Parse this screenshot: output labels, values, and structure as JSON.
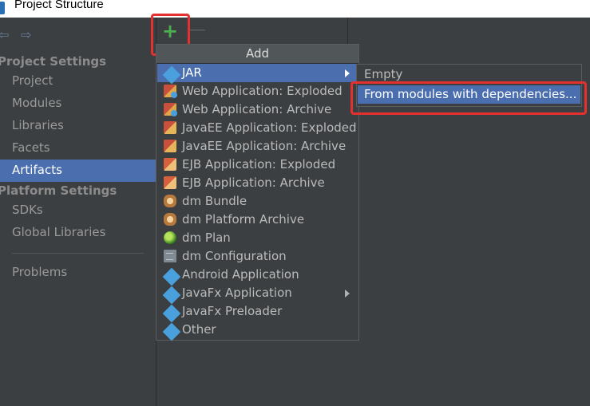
{
  "window": {
    "title": "Project Structure"
  },
  "sidebar": {
    "project_settings_header": "Project Settings",
    "project_items": [
      "Project",
      "Modules",
      "Libraries",
      "Facets",
      "Artifacts"
    ],
    "platform_settings_header": "Platform Settings",
    "platform_items": [
      "SDKs",
      "Global Libraries"
    ],
    "problems": "Problems",
    "selected": "Artifacts"
  },
  "toolbar": {
    "add_symbol": "+",
    "remove_symbol": "—"
  },
  "add_menu": {
    "title": "Add",
    "items": [
      {
        "label": "JAR",
        "icon": "jar-icon",
        "submenu": true,
        "selected": true
      },
      {
        "label": "Web Application: Exploded",
        "icon": "web-app-icon"
      },
      {
        "label": "Web Application: Archive",
        "icon": "web-app-icon"
      },
      {
        "label": "JavaEE Application: Exploded",
        "icon": "javaee-icon"
      },
      {
        "label": "JavaEE Application: Archive",
        "icon": "javaee-icon"
      },
      {
        "label": "EJB Application: Exploded",
        "icon": "ejb-icon"
      },
      {
        "label": "EJB Application: Archive",
        "icon": "ejb-icon"
      },
      {
        "label": "dm Bundle",
        "icon": "dm-bundle-icon"
      },
      {
        "label": "dm Platform Archive",
        "icon": "dm-bundle-icon"
      },
      {
        "label": "dm Plan",
        "icon": "dm-plan-icon"
      },
      {
        "label": "dm Configuration",
        "icon": "dm-config-icon"
      },
      {
        "label": "Android Application",
        "icon": "android-icon"
      },
      {
        "label": "JavaFx Application",
        "icon": "javafx-icon",
        "submenu": true
      },
      {
        "label": "JavaFx Preloader",
        "icon": "javafx-icon"
      },
      {
        "label": "Other",
        "icon": "other-icon"
      }
    ]
  },
  "jar_submenu": {
    "items": [
      {
        "label": "Empty"
      },
      {
        "label": "From modules with dependencies...",
        "selected": true
      }
    ]
  },
  "colors": {
    "accent": "#4b6eaf",
    "highlight_box": "#e53030",
    "background": "#3c3f41"
  }
}
